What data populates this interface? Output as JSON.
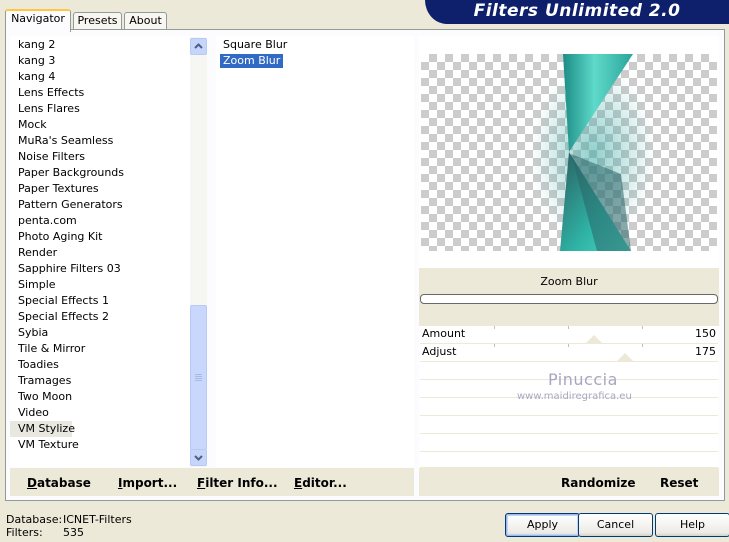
{
  "app": {
    "title": "Filters Unlimited 2.0"
  },
  "tabs": [
    {
      "label": "Navigator",
      "active": true
    },
    {
      "label": "Presets",
      "active": false
    },
    {
      "label": "About",
      "active": false
    }
  ],
  "categories": {
    "items": [
      "kang 2",
      "kang 3",
      "kang 4",
      "Lens Effects",
      "Lens Flares",
      "Mock",
      "MuRa's Seamless",
      "Noise Filters",
      "Paper Backgrounds",
      "Paper Textures",
      "Pattern Generators",
      "penta.com",
      "Photo Aging Kit",
      "Render",
      "Sapphire Filters 03",
      "Simple",
      "Special Effects 1",
      "Special Effects 2",
      "Sybia",
      "Tile & Mirror",
      "Toadies",
      "Tramages",
      "Two Moon",
      "Video",
      "VM Stylize",
      "VM Texture"
    ],
    "selected": "VM Stylize"
  },
  "filters": {
    "items": [
      "Square Blur",
      "Zoom Blur"
    ],
    "selected": "Zoom Blur"
  },
  "preview": {
    "filter_name": "Zoom Blur",
    "progress": 0
  },
  "params": [
    {
      "label": "Amount",
      "value": "150"
    },
    {
      "label": "Adjust",
      "value": "175"
    }
  ],
  "watermark": {
    "name": "Pinuccia",
    "url": "www.maidiregrafica.eu"
  },
  "bottom_buttons": {
    "database": {
      "label": "Database",
      "underline": "D"
    },
    "import": {
      "label": "Import...",
      "underline": "I"
    },
    "filter_info": {
      "label": "Filter Info...",
      "underline": "F"
    },
    "editor": {
      "label": "Editor...",
      "underline": "E"
    },
    "randomize": "Randomize",
    "reset": "Reset"
  },
  "status": {
    "database_label": "Database:",
    "database_value": "ICNET-Filters",
    "filters_label": "Filters:",
    "filters_value": "535"
  },
  "dialog_buttons": {
    "apply": "Apply",
    "cancel": "Cancel",
    "help": "Help"
  },
  "colors": {
    "banner": "#0e1f6b",
    "selection": "#316ac5",
    "face": "#ece9d8",
    "teal_light": "#53d3c3",
    "teal_dark": "#1f6f70"
  },
  "icons": {
    "scroll_up": "scroll-up-icon",
    "scroll_down": "scroll-down-icon"
  }
}
